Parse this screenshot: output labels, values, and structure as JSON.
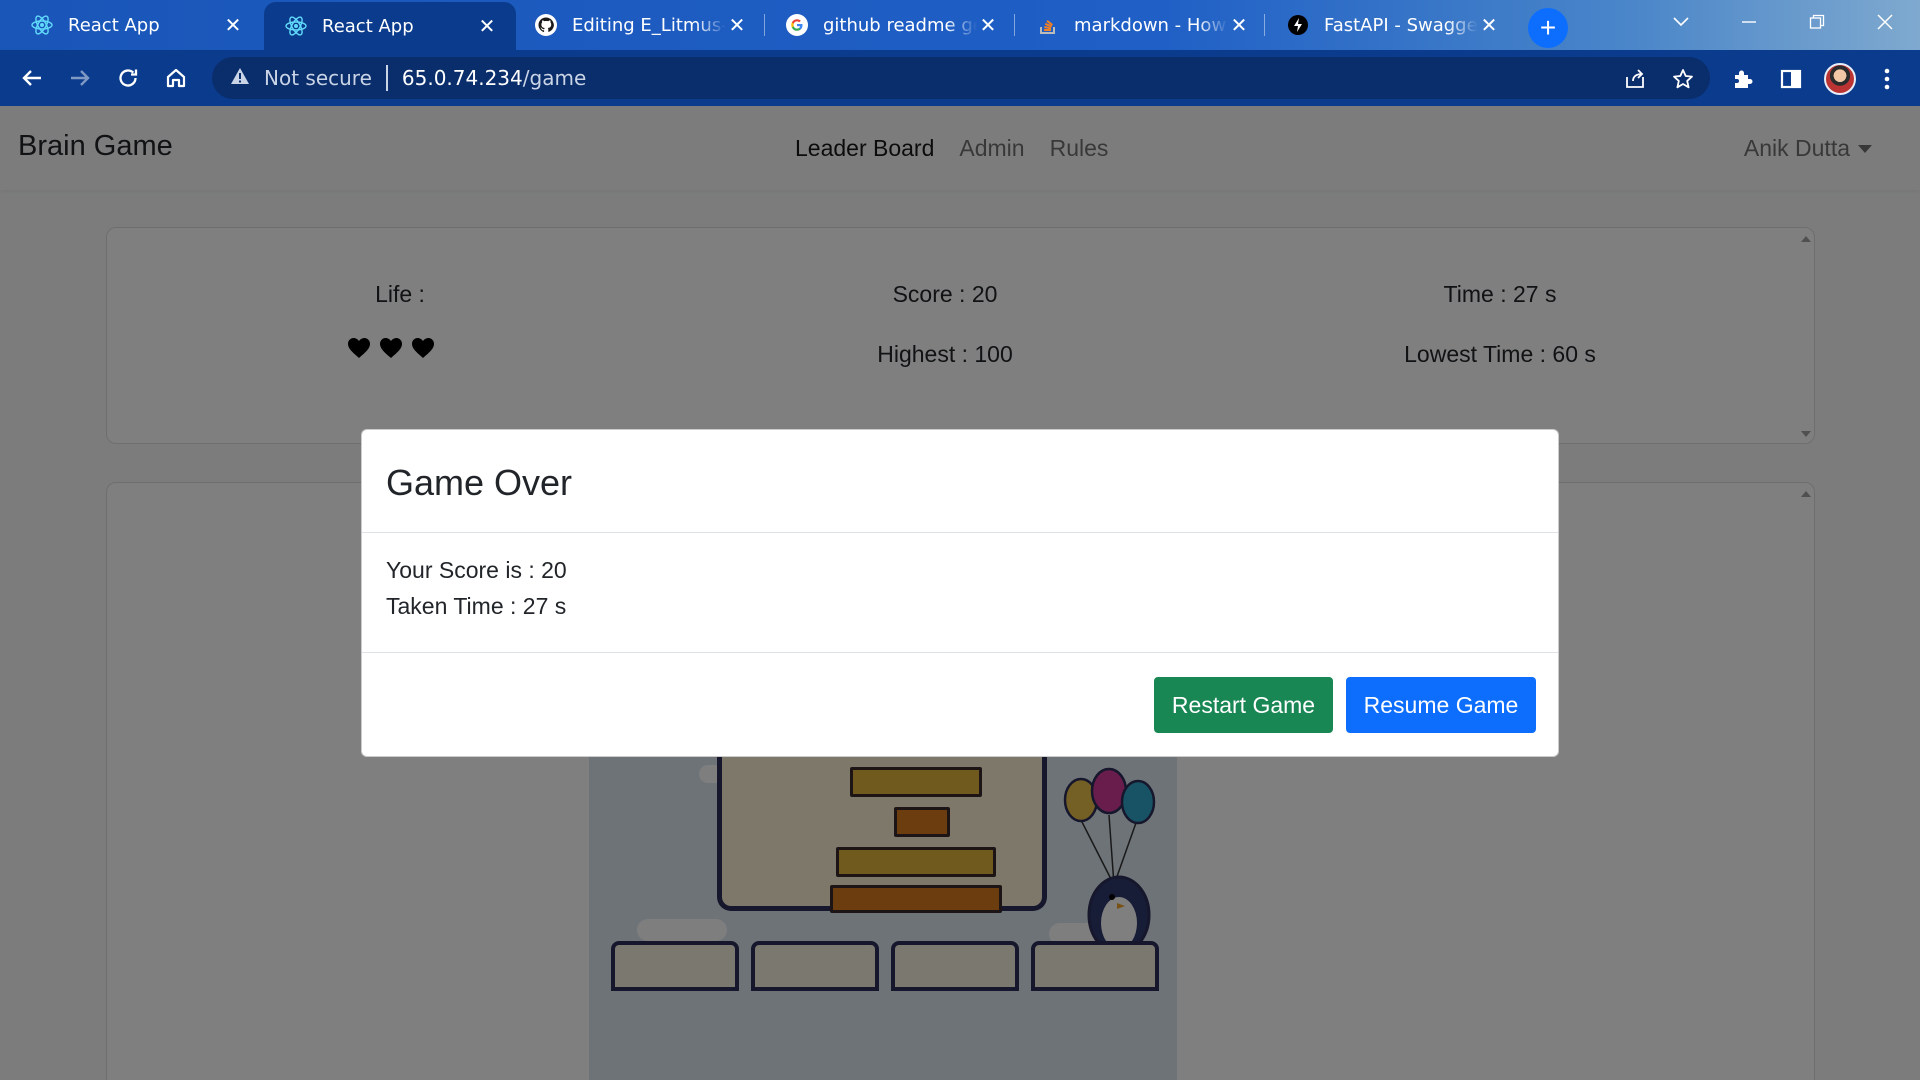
{
  "browser": {
    "tabs": [
      {
        "title": "React App",
        "favicon": "react-icon",
        "active": false
      },
      {
        "title": "React App",
        "favicon": "react-icon",
        "active": true
      },
      {
        "title": "Editing E_Litmus-Brain-Game",
        "favicon": "github-icon",
        "active": false
      },
      {
        "title": "github readme generator",
        "favicon": "google-icon",
        "active": false
      },
      {
        "title": "markdown - How to",
        "favicon": "stackoverflow-icon",
        "active": false
      },
      {
        "title": "FastAPI - Swagger UI",
        "favicon": "fastapi-icon",
        "active": false
      }
    ],
    "address": {
      "security_label": "Not secure",
      "host": "65.0.74.234",
      "path": "/game"
    }
  },
  "navbar": {
    "brand": "Brain Game",
    "links": [
      "Leader Board",
      "Admin",
      "Rules"
    ],
    "user": "Anik Dutta"
  },
  "stats": {
    "life_label": "Life :",
    "lives": 3,
    "score": "Score : 20",
    "highest": "Highest : 100",
    "time": "Time : 27 s",
    "lowest_time": "Lowest Time : 60 s"
  },
  "modal": {
    "title": "Game Over",
    "score_line": "Your Score is : 20",
    "time_line": "Taken Time : 27 s",
    "restart_label": "Restart Game",
    "resume_label": "Resume Game"
  },
  "colors": {
    "success": "#198754",
    "primary": "#0d6efd",
    "browser_tabbar": "#1a56b8",
    "browser_toolbar": "#0b3b8c"
  }
}
